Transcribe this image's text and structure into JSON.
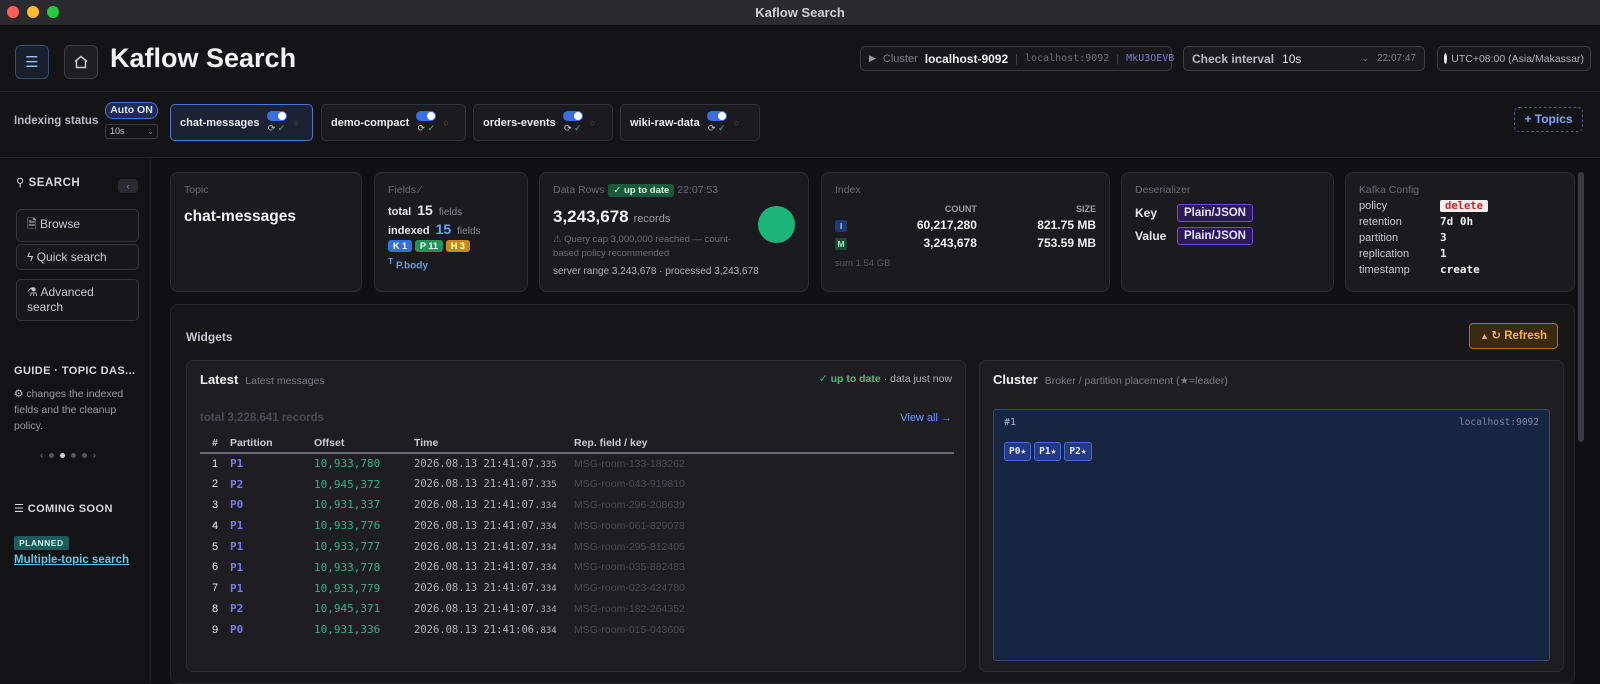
{
  "window": {
    "title": "Kaflow Search",
    "lights": [
      "#fe5f57",
      "#febc2e",
      "#28c840"
    ]
  },
  "header": {
    "title": "Kaflow Search",
    "cluster_label": "Cluster",
    "cluster_name": "localhost-9092",
    "cluster_addr": "localhost:9092",
    "cluster_id": "MkU3OEVB",
    "interval_label": "Check interval",
    "interval_value": "10s",
    "interval_time": "22:07:47",
    "timezone": "UTC+08:00 (Asia/Makassar)"
  },
  "indexing": {
    "label": "Indexing status",
    "auto_label": "Auto ON",
    "auto_interval": "10s",
    "topics": [
      {
        "name": "chat-messages",
        "active": true
      },
      {
        "name": "demo-compact",
        "active": false
      },
      {
        "name": "orders-events",
        "active": false
      },
      {
        "name": "wiki-raw-data",
        "active": false
      }
    ],
    "add_topics": "+ Topics"
  },
  "sidebar": {
    "heading": "SEARCH",
    "buttons": [
      {
        "icon": "document-icon",
        "label": "Browse"
      },
      {
        "icon": "bolt-icon",
        "label": "Quick search"
      },
      {
        "icon": "flask-icon",
        "label": "Advanced search"
      }
    ],
    "guide_heading": "GUIDE · TOPIC DAS...",
    "guide_text": "changes the indexed fields and the cleanup policy.",
    "soon_heading": "COMING SOON",
    "planned_badge": "PLANNED",
    "planned_link": "Multiple-topic search"
  },
  "cards": {
    "topic": {
      "label": "Topic",
      "value": "chat-messages"
    },
    "fields": {
      "label": "Fields",
      "total_label": "total",
      "total": "15",
      "total_unit": "fields",
      "indexed_label": "indexed",
      "indexed": "15",
      "indexed_unit": "fields",
      "tags": [
        {
          "text": "K 1",
          "color": "#2f6fe0"
        },
        {
          "text": "P 11",
          "color": "#23935a"
        },
        {
          "text": "H 3",
          "color": "#c98a1a"
        }
      ],
      "body": "P.body"
    },
    "rows": {
      "label": "Data Rows",
      "badge": "✓ up to date",
      "time": "22:07:53",
      "count": "3,243,678",
      "unit": "records",
      "note": "⚠ Query cap 3,000,000 reached — count-based policy recommended",
      "server": "server range 3,243,678 · processed 3,243,678"
    },
    "index": {
      "label": "Index",
      "col_count": "COUNT",
      "col_size": "SIZE",
      "rows": [
        {
          "icon": "I",
          "count": "60,217,280",
          "size": "821.75 MB"
        },
        {
          "icon": "M",
          "count": "3,243,678",
          "size": "753.59 MB"
        }
      ],
      "sum": "sum 1.54 GB"
    },
    "deser": {
      "label": "Deserializer",
      "key_label": "Key",
      "key": "Plain/JSON",
      "value_label": "Value",
      "value": "Plain/JSON"
    },
    "kafka": {
      "label": "Kafka Config",
      "rows": [
        {
          "k": "policy",
          "v": "delete"
        },
        {
          "k": "retention",
          "v": "7d 0h"
        },
        {
          "k": "partition",
          "v": "3"
        },
        {
          "k": "replication",
          "v": "1"
        },
        {
          "k": "timestamp",
          "v": "create"
        }
      ]
    }
  },
  "widgets": {
    "title": "Widgets",
    "refresh": "↻ Refresh",
    "latest": {
      "title": "Latest",
      "subtitle": "Latest messages",
      "status_ok": "✓ up to date",
      "status_rest": "· data just now",
      "total": "total 3,228,641 records",
      "view_all": "View all →",
      "columns": [
        "#",
        "Partition",
        "Offset",
        "Time",
        "Rep. field / key"
      ],
      "rows": [
        {
          "n": "1",
          "p": "P1",
          "off": "10,933,780",
          "t": "2026.08.13 21:41:07.",
          "ms": "335",
          "key": "MSG-room-133-183262"
        },
        {
          "n": "2",
          "p": "P2",
          "off": "10,945,372",
          "t": "2026.08.13 21:41:07.",
          "ms": "335",
          "key": "MSG-room-043-919810"
        },
        {
          "n": "3",
          "p": "P0",
          "off": "10,931,337",
          "t": "2026.08.13 21:41:07.",
          "ms": "334",
          "key": "MSG-room-296-208639"
        },
        {
          "n": "4",
          "p": "P1",
          "off": "10,933,776",
          "t": "2026.08.13 21:41:07.",
          "ms": "334",
          "key": "MSG-room-061-829078"
        },
        {
          "n": "5",
          "p": "P1",
          "off": "10,933,777",
          "t": "2026.08.13 21:41:07.",
          "ms": "334",
          "key": "MSG-room-295-812405"
        },
        {
          "n": "6",
          "p": "P1",
          "off": "10,933,778",
          "t": "2026.08.13 21:41:07.",
          "ms": "334",
          "key": "MSG-room-035-882483"
        },
        {
          "n": "7",
          "p": "P1",
          "off": "10,933,779",
          "t": "2026.08.13 21:41:07.",
          "ms": "334",
          "key": "MSG-room-023-424780"
        },
        {
          "n": "8",
          "p": "P2",
          "off": "10,945,371",
          "t": "2026.08.13 21:41:07.",
          "ms": "334",
          "key": "MSG-room-182-264352"
        },
        {
          "n": "9",
          "p": "P0",
          "off": "10,931,336",
          "t": "2026.08.13 21:41:06.",
          "ms": "834",
          "key": "MSG-room-015-043606"
        }
      ]
    },
    "cluster": {
      "title": "Cluster",
      "subtitle": "Broker / partition placement (★=leader)",
      "broker_id": "#1",
      "broker_host": "localhost:9092",
      "partitions": [
        "P0★",
        "P1★",
        "P2★"
      ]
    }
  }
}
